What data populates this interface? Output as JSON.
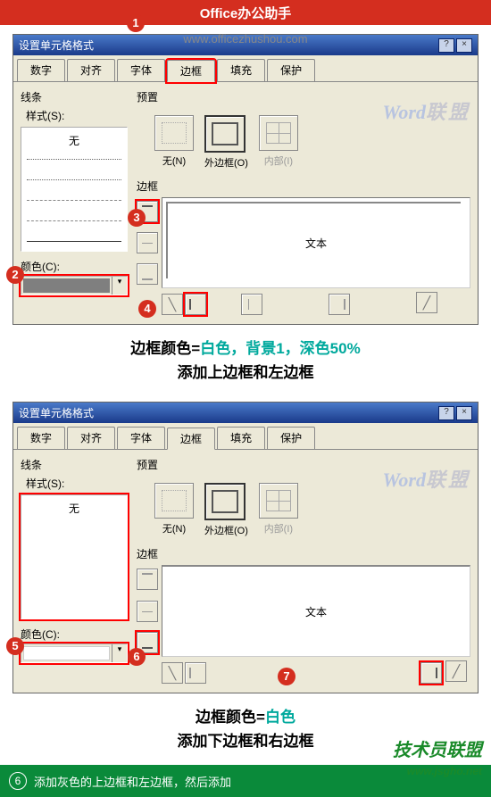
{
  "banner": {
    "title": "Office办公助手",
    "url": "www.officezhushou.com"
  },
  "dialog": {
    "title": "设置单元格格式",
    "tabs": {
      "number": "数字",
      "align": "对齐",
      "font": "字体",
      "border": "边框",
      "fill": "填充",
      "protect": "保护"
    },
    "groups": {
      "lines": "线条",
      "style": "样式(S):",
      "style_none": "无",
      "color": "颜色(C):",
      "preset": "预置",
      "border": "边框"
    },
    "presets": {
      "none": "无(N)",
      "outer": "外边框(O)",
      "inner": "内部(I)"
    },
    "preview_text": "文本"
  },
  "caption1": {
    "line1_a": "边框颜色=",
    "line1_b": "白色，背景1，深色50%",
    "line2": "添加上边框和左边框"
  },
  "caption2": {
    "line1_a": "边框颜色=",
    "line1_b": "白色",
    "line2": "添加下边框和右边框"
  },
  "watermark": {
    "en": "Word",
    "zh": "联盟"
  },
  "footer_logo": {
    "text": "技术员联盟",
    "url": "www.jsgho.net"
  },
  "bottom_step": {
    "num": "6",
    "text": "添加灰色的上边框和左边框，然后添加"
  }
}
